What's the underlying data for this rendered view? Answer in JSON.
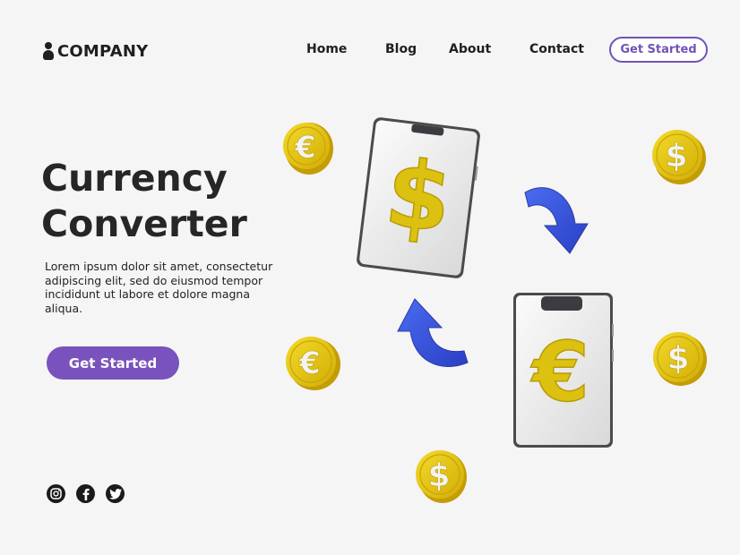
{
  "brand": {
    "name": "COMPANY"
  },
  "nav": {
    "items": [
      {
        "label": "Home"
      },
      {
        "label": "Blog"
      },
      {
        "label": "About"
      },
      {
        "label": "Contact"
      }
    ],
    "cta_label": "Get Started"
  },
  "hero": {
    "title_line1": "Currency",
    "title_line2": "Converter",
    "description": "Lorem ipsum dolor sit amet, consectetur adipiscing elit, sed do eiusmod tempor incididunt ut labore et dolore magna aliqua.",
    "cta_label": "Get Started"
  },
  "social": [
    "instagram-icon",
    "facebook-icon",
    "twitter-icon"
  ],
  "illustration": {
    "phone_symbols": [
      "$",
      "€"
    ],
    "coin_symbols": [
      "€",
      "$",
      "€",
      "$",
      "$"
    ]
  },
  "colors": {
    "accent": "#7a52bd",
    "coin_gold": "#e1c20b",
    "arrow_blue": "#3553d6",
    "text_dark": "#262626"
  }
}
